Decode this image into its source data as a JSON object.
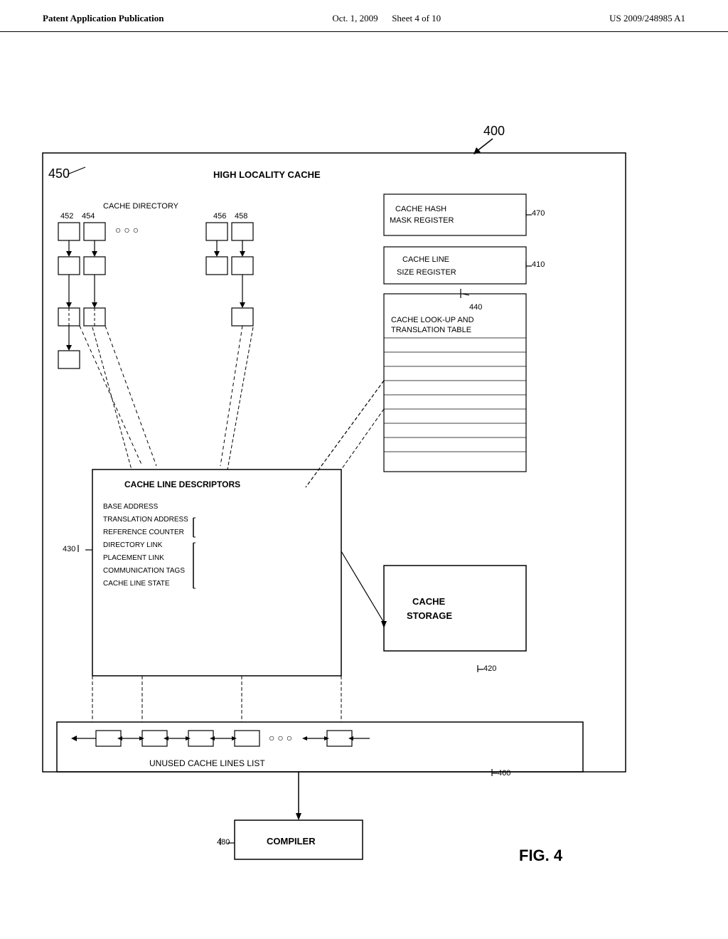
{
  "header": {
    "left": "Patent Application Publication",
    "center": "Oct. 1, 2009",
    "sheet": "Sheet 4 of 10",
    "right": "US 2009/248985 A1"
  },
  "diagram": {
    "fig_label": "FIG. 4",
    "main_ref": "400",
    "outer_box_ref": "450",
    "outer_box_label": "HIGH LOCALITY CACHE",
    "cache_dir_label": "CACHE DIRECTORY",
    "cd_ref1": "452",
    "cd_ref2": "454",
    "cd_ref3": "456",
    "cd_ref4": "458",
    "cache_hash_label1": "CACHE HASH",
    "cache_hash_label2": "MASK REGISTER",
    "cache_hash_ref": "470",
    "cache_line_size_label1": "CACHE LINE",
    "cache_line_size_label2": "SIZE REGISTER",
    "cache_line_size_ref": "410",
    "lookup_ref": "440",
    "lookup_label1": "CACHE LOOK-UP AND",
    "lookup_label2": "TRANSLATION TABLE",
    "desc_label": "CACHE LINE DESCRIPTORS",
    "base_addr": "BASE ADDRESS",
    "trans_addr": "TRANSLATION ADDRESS",
    "ref_counter": "REFERENCE COUNTER",
    "dir_link": "DIRECTORY LINK",
    "place_link": "PLACEMENT LINK",
    "comm_tags": "COMMUNICATION TAGS",
    "cache_line_state": "CACHE LINE STATE",
    "desc_ref": "430",
    "cache_storage_label1": "CACHE",
    "cache_storage_label2": "STORAGE",
    "cache_storage_ref": "420",
    "unused_label": "UNUSED CACHE LINES LIST",
    "unused_ref": "460",
    "compiler_label": "COMPILER",
    "compiler_ref": "480"
  }
}
